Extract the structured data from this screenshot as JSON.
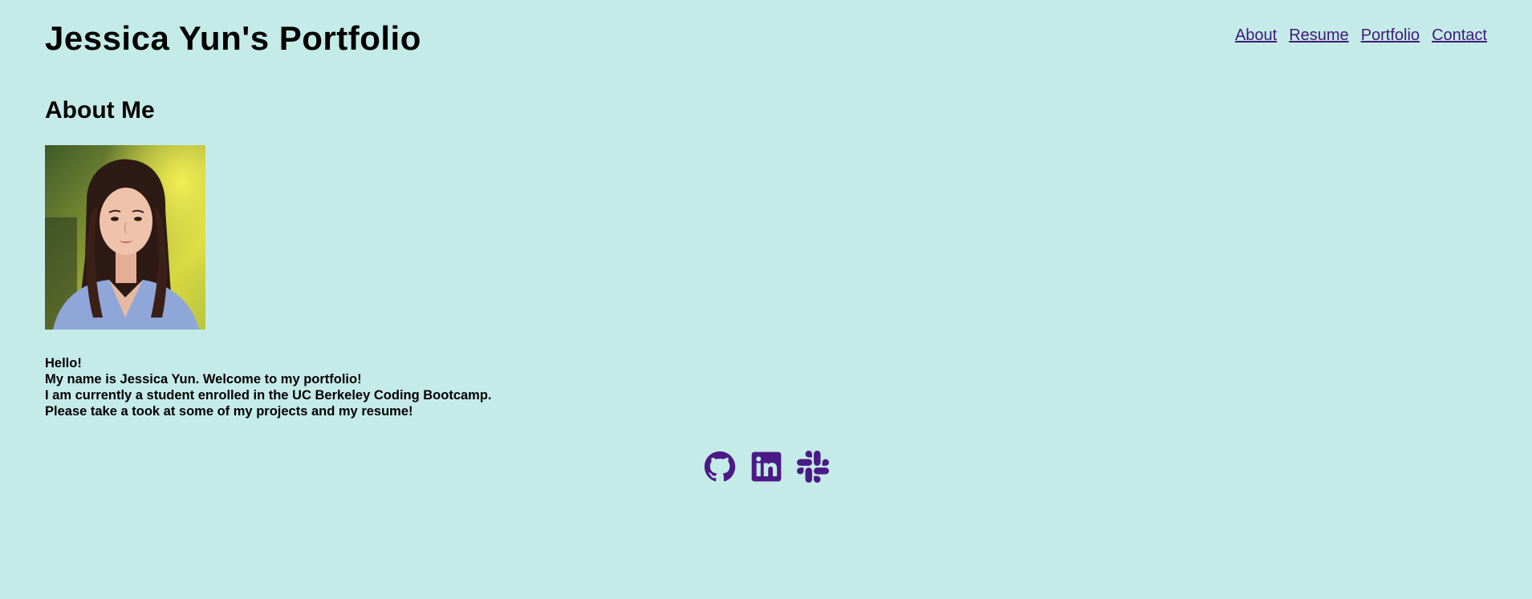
{
  "header": {
    "title": "Jessica Yun's Portfolio",
    "nav": [
      {
        "label": "About"
      },
      {
        "label": "Resume"
      },
      {
        "label": "Portfolio"
      },
      {
        "label": "Contact"
      }
    ]
  },
  "about": {
    "heading": "About Me",
    "photo_alt": "Photo of Jessica Yun",
    "bio_lines": [
      "Hello!",
      "My name is Jessica Yun. Welcome to my portfolio!",
      "I am currently a student enrolled in the UC Berkeley Coding Bootcamp.",
      "Please take a took at some of my projects and my resume!"
    ]
  },
  "social": {
    "icons": [
      "github-icon",
      "linkedin-icon",
      "slack-icon"
    ]
  },
  "colors": {
    "background": "#c5ebe9",
    "link": "#3f1a7a",
    "icon": "#4a1a86"
  }
}
